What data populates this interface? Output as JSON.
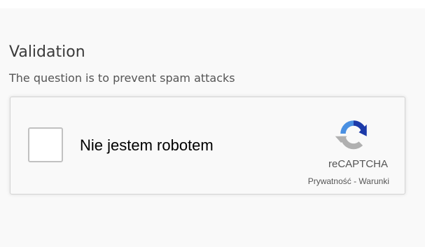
{
  "validation": {
    "title": "Validation",
    "subtitle": "The question is to prevent spam attacks"
  },
  "recaptcha": {
    "checkbox_label": "Nie jestem robotem",
    "checked": false,
    "brand": "reCAPTCHA",
    "privacy_link": "Prywatność",
    "separator": " - ",
    "terms_link": "Warunki",
    "logo_icon": "recaptcha-logo-icon",
    "colors": {
      "logo_blue_dark": "#1c3aa9",
      "logo_blue_light": "#4a90e2",
      "logo_gray": "#b0b0b0",
      "border": "#d3d3d3",
      "background": "#f9f9f9"
    }
  }
}
